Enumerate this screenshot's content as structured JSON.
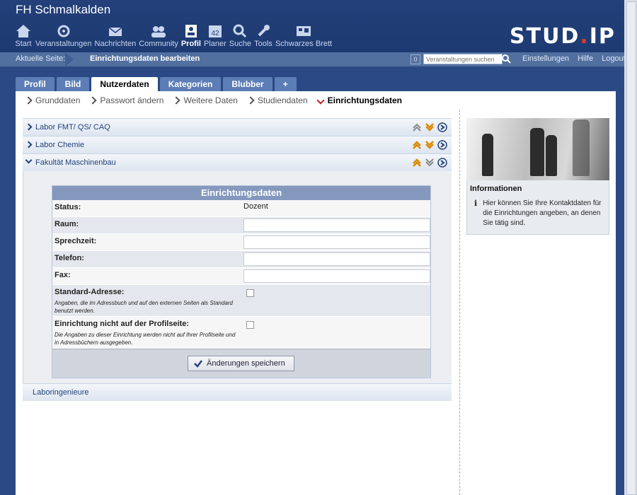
{
  "site_title": "FH Schmalkalden",
  "nav": [
    {
      "label": "Start",
      "icon": "home-icon"
    },
    {
      "label": "Veranstaltungen",
      "icon": "courses-icon"
    },
    {
      "label": "Nachrichten",
      "icon": "mail-icon"
    },
    {
      "label": "Community",
      "icon": "community-icon"
    },
    {
      "label": "Profil",
      "icon": "profile-icon",
      "active": true
    },
    {
      "label": "Planer",
      "icon": "calendar-icon",
      "badge": "42"
    },
    {
      "label": "Suche",
      "icon": "search-icon"
    },
    {
      "label": "Tools",
      "icon": "wrench-icon"
    },
    {
      "label": "Schwarzes Brett",
      "icon": "board-icon"
    }
  ],
  "logo": {
    "part1": "STUD",
    "dot": ".",
    "part2": "IP"
  },
  "breadcrumb": {
    "label": "Aktuelle Seite:",
    "page": "Einrichtungsdaten bearbeiten"
  },
  "search": {
    "count": "0",
    "placeholder": "Veranstaltungen suchen"
  },
  "header_links": [
    "Einstellungen",
    "Hilfe",
    "Logout"
  ],
  "tabs": [
    "Profil",
    "Bild",
    "Nutzerdaten",
    "Kategorien",
    "Blubber",
    "+"
  ],
  "active_tab": "Nutzerdaten",
  "subnav": [
    "Grunddaten",
    "Passwort ändern",
    "Weitere Daten",
    "Studiendaten",
    "Einrichtungsdaten"
  ],
  "institutes": [
    "Labor FMT/ QS/ CAQ",
    "Labor Chemie",
    "Fakultät Maschinenbau"
  ],
  "form": {
    "title": "Einrichtungsdaten",
    "status_label": "Status:",
    "status_value": "Dozent",
    "fields": [
      "Raum:",
      "Sprechzeit:",
      "Telefon:",
      "Fax:"
    ],
    "standard_label": "Standard-Adresse:",
    "standard_desc": "Angaben, die im Adressbuch und auf den externen Seiten als Standard benutzt werden.",
    "hide_label": "Einrichtung nicht auf der Profilseite:",
    "hide_desc": "Die Angaben zu dieser Einrichtung werden nicht auf Ihrer Profilseite und in Adressbüchern ausgegeben.",
    "save_label": "Änderungen speichern"
  },
  "last_institute": "Laboringenieure",
  "sidebar": {
    "heading": "Informationen",
    "text": "Hier können Sie Ihre Kontaktdaten für die Einrichtungen angeben, an denen Sie tätig sind."
  },
  "colors": {
    "header": "#23407a",
    "tab": "#5c7db5",
    "form_header": "#8498bd",
    "accent_red": "#cc1d1d",
    "arrow_orange": "#d88a00"
  }
}
